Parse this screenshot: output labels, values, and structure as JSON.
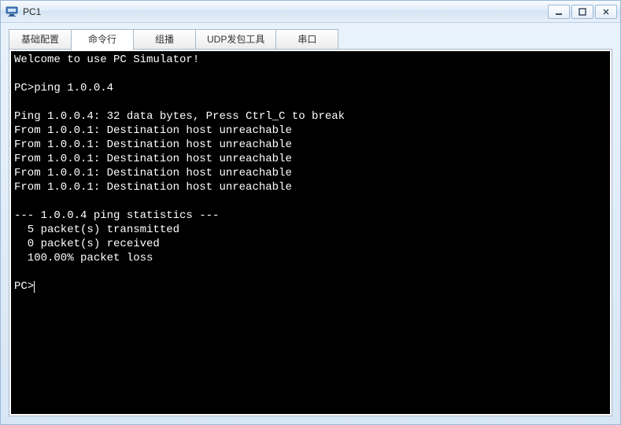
{
  "window": {
    "title": "PC1"
  },
  "tabs": {
    "items": [
      {
        "label": "基础配置"
      },
      {
        "label": "命令行"
      },
      {
        "label": "组播"
      },
      {
        "label": "UDP发包工具"
      },
      {
        "label": "串口"
      }
    ],
    "active_index": 1
  },
  "terminal": {
    "lines": [
      "Welcome to use PC Simulator!",
      "",
      "PC>ping 1.0.0.4",
      "",
      "Ping 1.0.0.4: 32 data bytes, Press Ctrl_C to break",
      "From 1.0.0.1: Destination host unreachable",
      "From 1.0.0.1: Destination host unreachable",
      "From 1.0.0.1: Destination host unreachable",
      "From 1.0.0.1: Destination host unreachable",
      "From 1.0.0.1: Destination host unreachable",
      "",
      "--- 1.0.0.4 ping statistics ---",
      "  5 packet(s) transmitted",
      "  0 packet(s) received",
      "  100.00% packet loss",
      "",
      "PC>"
    ],
    "prompt": "PC>"
  }
}
